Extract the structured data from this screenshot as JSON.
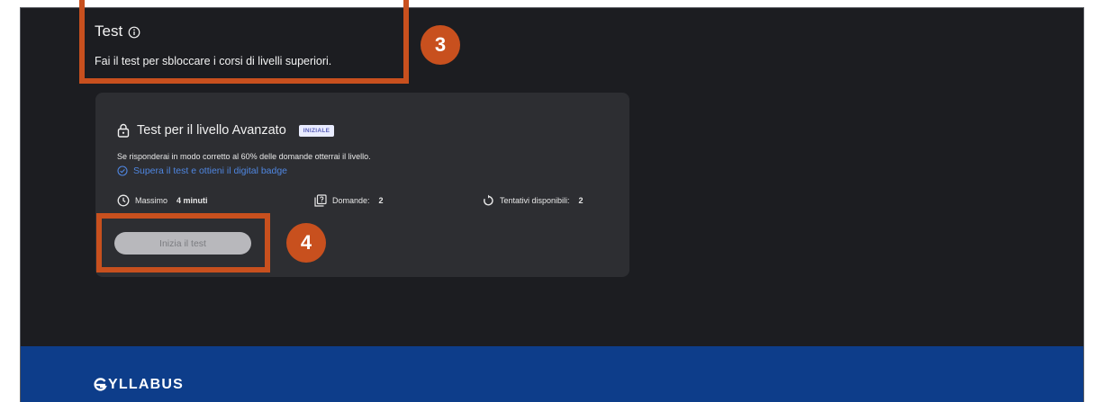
{
  "section": {
    "title": "Test",
    "subtitle": "Fai il test per sbloccare i corsi di livelli superiori."
  },
  "card": {
    "title": "Test per il livello Avanzato",
    "badge": "INIZIALE",
    "description": "Se risponderai in modo corretto al 60% delle domande otterrai il livello.",
    "link": "Supera il test e ottieni il digital badge",
    "meta": {
      "duration_label": "Massimo",
      "duration_value": "4 minuti",
      "questions_label": "Domande:",
      "questions_value": "2",
      "attempts_label": "Tentativi disponibili:",
      "attempts_value": "2"
    },
    "start_button": "Inizia il test"
  },
  "footer": {
    "logo": "YLLABUS"
  },
  "annotations": {
    "marker_3": "3",
    "marker_4": "4"
  },
  "icons": [
    "info-icon",
    "lock-icon",
    "check-circle-icon",
    "clock-icon",
    "questions-icon",
    "retry-icon",
    "syllabus-logo-icon"
  ],
  "colors": {
    "background": "#1c1d21",
    "card": "#2d2e32",
    "link": "#4f86e0",
    "highlight": "#c8501e",
    "footer": "#0d3d8a"
  }
}
